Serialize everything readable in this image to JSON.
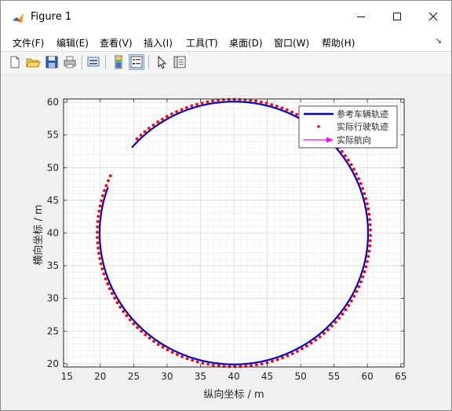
{
  "window": {
    "title": "Figure 1"
  },
  "menu": [
    {
      "label": "文件(F)"
    },
    {
      "label": "编辑(E)"
    },
    {
      "label": "查看(V)"
    },
    {
      "label": "插入(I)"
    },
    {
      "label": "工具(T)"
    },
    {
      "label": "桌面(D)"
    },
    {
      "label": "窗口(W)"
    },
    {
      "label": "帮助(H)"
    }
  ],
  "toolbar": [
    {
      "icon": "new-figure-icon"
    },
    {
      "icon": "open-file-icon"
    },
    {
      "icon": "save-icon"
    },
    {
      "icon": "print-icon"
    },
    {
      "icon": "link-plot-icon"
    },
    {
      "icon": "colorbar-icon"
    },
    {
      "icon": "legend-icon"
    },
    {
      "icon": "pointer-icon"
    },
    {
      "icon": "property-inspector-icon"
    }
  ],
  "chart_data": {
    "type": "line",
    "xlabel": "纵向坐标 / m",
    "ylabel": "横向坐标 / m",
    "xlim": [
      14.5,
      65.5
    ],
    "ylim": [
      19.5,
      60.5
    ],
    "xticks": [
      15,
      20,
      25,
      30,
      35,
      40,
      45,
      50,
      55,
      60,
      65
    ],
    "yticks": [
      20,
      25,
      30,
      35,
      40,
      45,
      50,
      55,
      60
    ],
    "grid": "minor",
    "legend_position": "top-right",
    "series": [
      {
        "name": "参考车辆轨迹",
        "style": "solid-line",
        "color": "#0000cc",
        "shape": "circular-arc",
        "center": [
          40,
          40
        ],
        "radius": 20.1,
        "start": [
          24.8,
          53.0
        ],
        "end": [
          21.4,
          46.9
        ]
      },
      {
        "name": "实际行驶轨迹",
        "style": "dots",
        "color": "#ff0000",
        "shape": "circular-arc",
        "center": [
          40,
          40
        ],
        "radius": 20.45,
        "start": [
          25.6,
          54.3
        ],
        "end": [
          21.6,
          48.7
        ]
      },
      {
        "name": "实际航向",
        "style": "arrow",
        "color": "#ff00ff"
      }
    ]
  },
  "colors": {
    "reference": "#0000cc",
    "actual": "#ff0000",
    "heading": "#ff00ff"
  }
}
